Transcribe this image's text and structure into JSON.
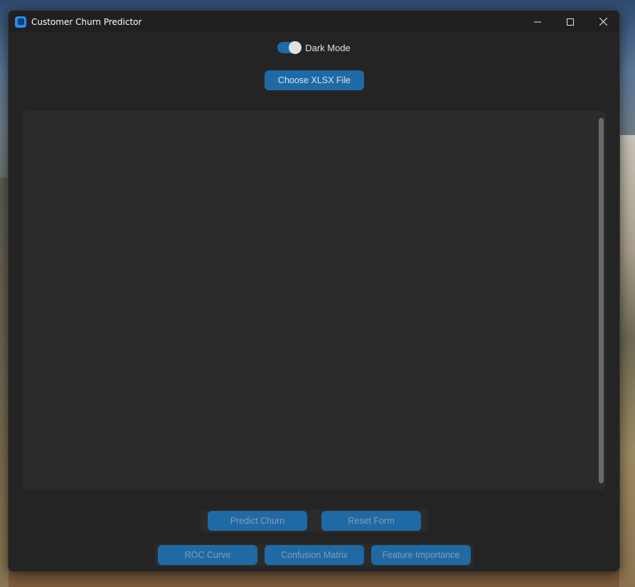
{
  "window": {
    "title": "Customer Churn Predictor",
    "controls": [
      "minimize",
      "maximize",
      "close"
    ]
  },
  "appearance": {
    "toggle_label": "Dark Mode",
    "toggle_on": true
  },
  "file": {
    "choose_label": "Choose XLSX File"
  },
  "actions": {
    "predict_label": "Predict Churn",
    "reset_label": "Reset Form"
  },
  "charts": {
    "roc_label": "ROC Curve",
    "confusion_label": "Confusion Matrix",
    "feature_label": "Feature Importance"
  },
  "colors": {
    "accent": "#1f6aa5",
    "window_bg": "#242424",
    "panel_bg": "#2b2b2b"
  }
}
